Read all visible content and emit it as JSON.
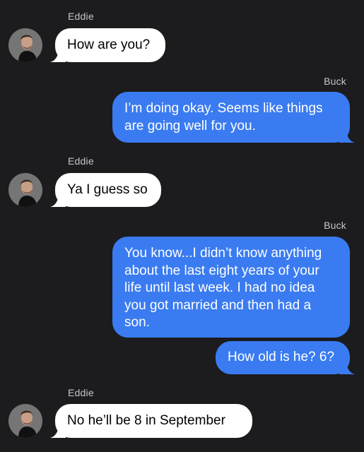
{
  "messages": [
    {
      "sender": "Eddie",
      "direction": "incoming",
      "text": "How are you?"
    },
    {
      "sender": "Buck",
      "direction": "outgoing",
      "text": "I’m doing okay. Seems like things are going well for you."
    },
    {
      "sender": "Eddie",
      "direction": "incoming",
      "text": "Ya I guess so"
    },
    {
      "sender": "Buck",
      "direction": "outgoing",
      "text": "You know...I didn’t know anything about the last eight years of your life until last week. I had no idea you got married and then had a son."
    },
    {
      "sender": "",
      "direction": "outgoing",
      "text": "How old is he? 6?"
    },
    {
      "sender": "Eddie",
      "direction": "incoming",
      "text": "No he’ll be 8 in September"
    }
  ],
  "colors": {
    "background": "#1c1c1e",
    "incoming_bubble": "#ffffff",
    "outgoing_bubble": "#3a7bf1",
    "sender_name": "#c7c7cc"
  },
  "icons": {
    "avatar": "contact-avatar-photo"
  }
}
